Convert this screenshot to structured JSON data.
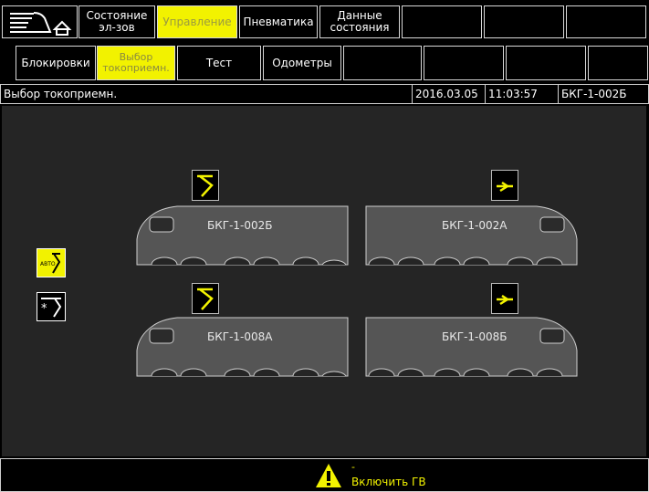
{
  "top_tabs": [
    {
      "id": "home",
      "label": ""
    },
    {
      "id": "state-el",
      "label": "Состояние\nэл-зов"
    },
    {
      "id": "control",
      "label": "Управление"
    },
    {
      "id": "pneumatics",
      "label": "Пневматика"
    },
    {
      "id": "data-state",
      "label": "Данные\nсостояния"
    }
  ],
  "sub_tabs": [
    {
      "id": "blocks",
      "label": "Блокировки"
    },
    {
      "id": "panto-select",
      "label": "Выбор\nтокоприемн."
    },
    {
      "id": "test",
      "label": "Тест"
    },
    {
      "id": "odometers",
      "label": "Одометры"
    }
  ],
  "status": {
    "title": "Выбор токоприемн.",
    "date": "2016.03.05",
    "time": "11:03:57",
    "unit": "БКГ-1-002Б"
  },
  "locomotives": [
    {
      "name": "БКГ-1-002Б",
      "pantograph": "raised"
    },
    {
      "name": "БКГ-1-002А",
      "pantograph": "lowered"
    },
    {
      "name": "БКГ-1-008А",
      "pantograph": "raised"
    },
    {
      "name": "БКГ-1-008Б",
      "pantograph": "lowered"
    }
  ],
  "mode_buttons": {
    "auto_label": "АВТО"
  },
  "alert": {
    "line1": "-",
    "line2": "Включить ГВ",
    "icon": "warning-icon"
  },
  "colors": {
    "accent": "#f2f200",
    "panel": "#252525",
    "loco": "#555555"
  }
}
